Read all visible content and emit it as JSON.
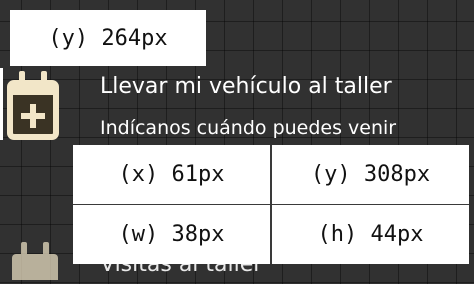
{
  "menu": {
    "items": [
      {
        "title": "Llevar mi vehículo al taller",
        "subtitle": "Indícanos cuándo puedes venir",
        "icon": "calendar-plus-icon"
      },
      {
        "title": "Visitas al taller",
        "icon": "calendar-icon"
      }
    ]
  },
  "overlay": {
    "top_label": "(y) 264px",
    "cells": [
      "(x) 61px",
      "(y) 308px",
      "(w) 38px",
      "(h) 44px"
    ]
  },
  "colors": {
    "background": "#313131",
    "icon": "#f2e6c8",
    "icon_fill": "#3a3324",
    "text": "#ffffff",
    "tooltip_bg": "#ffffff"
  }
}
